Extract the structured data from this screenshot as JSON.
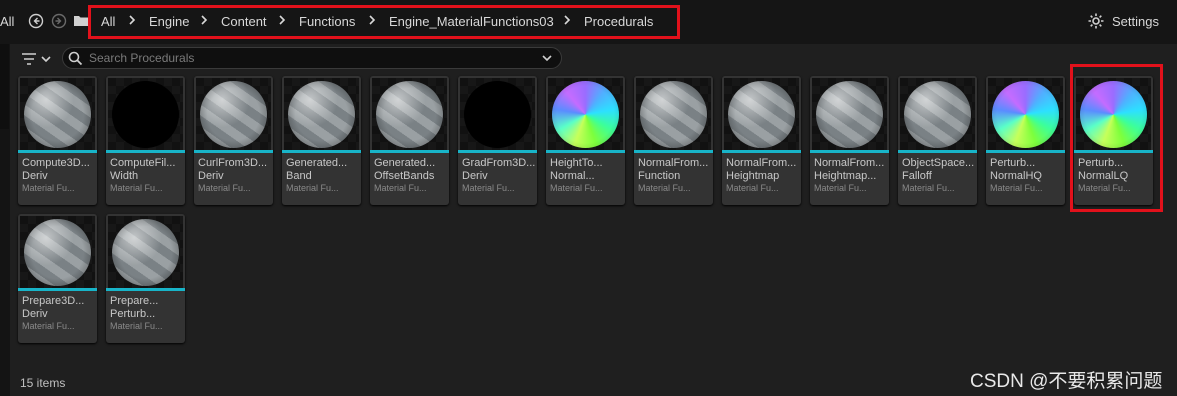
{
  "nav": {
    "all_label": "All",
    "breadcrumb": [
      "All",
      "Engine",
      "Content",
      "Functions",
      "Engine_MaterialFunctions03",
      "Procedurals"
    ],
    "settings_label": "Settings"
  },
  "search": {
    "placeholder": "Search Procedurals"
  },
  "assets": [
    {
      "name1": "Compute3D...",
      "name2": "Deriv",
      "type": "Material Fu...",
      "thumb": "grey"
    },
    {
      "name1": "ComputeFil...",
      "name2": "Width",
      "type": "Material Fu...",
      "thumb": "black"
    },
    {
      "name1": "CurlFrom3D...",
      "name2": "Deriv",
      "type": "Material Fu...",
      "thumb": "grey"
    },
    {
      "name1": "Generated...",
      "name2": "Band",
      "type": "Material Fu...",
      "thumb": "grey"
    },
    {
      "name1": "Generated...",
      "name2": "OffsetBands",
      "type": "Material Fu...",
      "thumb": "grey"
    },
    {
      "name1": "GradFrom3D...",
      "name2": "Deriv",
      "type": "Material Fu...",
      "thumb": "black"
    },
    {
      "name1": "HeightTo...",
      "name2": "Normal...",
      "type": "Material Fu...",
      "thumb": "normal"
    },
    {
      "name1": "NormalFrom...",
      "name2": "Function",
      "type": "Material Fu...",
      "thumb": "grey"
    },
    {
      "name1": "NormalFrom...",
      "name2": "Heightmap",
      "type": "Material Fu...",
      "thumb": "grey"
    },
    {
      "name1": "NormalFrom...",
      "name2": "Heightmap...",
      "type": "Material Fu...",
      "thumb": "grey"
    },
    {
      "name1": "ObjectSpace...",
      "name2": "Falloff",
      "type": "Material Fu...",
      "thumb": "grey"
    },
    {
      "name1": "Perturb...",
      "name2": "NormalHQ",
      "type": "Material Fu...",
      "thumb": "normal"
    },
    {
      "name1": "Perturb...",
      "name2": "NormalLQ",
      "type": "Material Fu...",
      "thumb": "normal"
    },
    {
      "name1": "Prepare3D...",
      "name2": "Deriv",
      "type": "Material Fu...",
      "thumb": "grey"
    },
    {
      "name1": "Prepare...",
      "name2": "Perturb...",
      "type": "Material Fu...",
      "thumb": "grey"
    }
  ],
  "status": {
    "item_count": "15 items"
  },
  "watermark": "CSDN @不要积累问题",
  "colors": {
    "accent": "#18b4c8",
    "highlight": "#e2111b"
  }
}
